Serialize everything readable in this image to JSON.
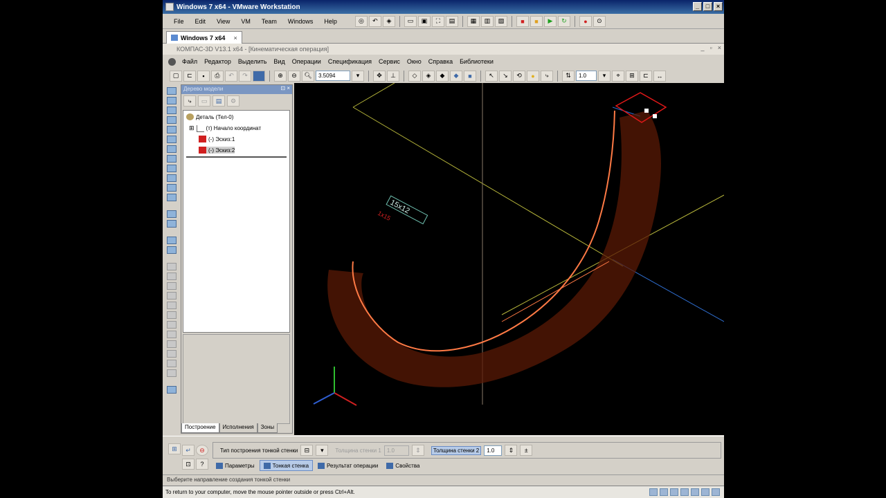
{
  "vmware": {
    "title": "Windows 7 x64 - VMware Workstation",
    "menu": [
      "File",
      "Edit",
      "View",
      "VM",
      "Team",
      "Windows",
      "Help"
    ],
    "tab_label": "Windows 7 x64",
    "tab_close": "×",
    "statusbar": "To return to your computer, move the mouse pointer outside or press Ctrl+Alt."
  },
  "kompas": {
    "title": "КОМПАС-3D V13.1 x64 - [Кинематическая операция]",
    "menu": [
      "Файл",
      "Редактор",
      "Выделить",
      "Вид",
      "Операции",
      "Спецификация",
      "Сервис",
      "Окно",
      "Справка",
      "Библиотеки"
    ],
    "scale_value": "3.5094",
    "step_value": "1.0"
  },
  "tree": {
    "header": "Дерево модели",
    "items": [
      "Деталь (Тел-0)",
      "(т) Начало координат",
      "(-) Эскиз:1",
      "(-) Эскиз:2"
    ],
    "tabs": [
      "Построение",
      "Исполнения",
      "Зоны"
    ]
  },
  "viewport": {
    "dim_label_1": "15x12",
    "dim_label_2": "1x15",
    "colors": {
      "path": "#ff7a45",
      "body": "#5a1a06",
      "axis_yellow": "#b5b43a",
      "axis_blue": "#2f6fd2",
      "axis_gray": "#8a7a6a",
      "sketch_red": "#e01818",
      "triad_green": "#2fbf2f",
      "triad_red": "#d02020",
      "triad_blue": "#2f5fd2"
    }
  },
  "propbar": {
    "type_label": "Тип построения тонкой стенки",
    "thick1_label": "Толщина стенки 1",
    "thick1_value": "1.0",
    "thick2_label": "Толщина стенки 2",
    "thick2_value": "1.0",
    "tabs": [
      "Параметры",
      "Тонкая стенка",
      "Результат операции",
      "Свойства"
    ]
  },
  "status": "Выберите направление создания тонкой стенки"
}
